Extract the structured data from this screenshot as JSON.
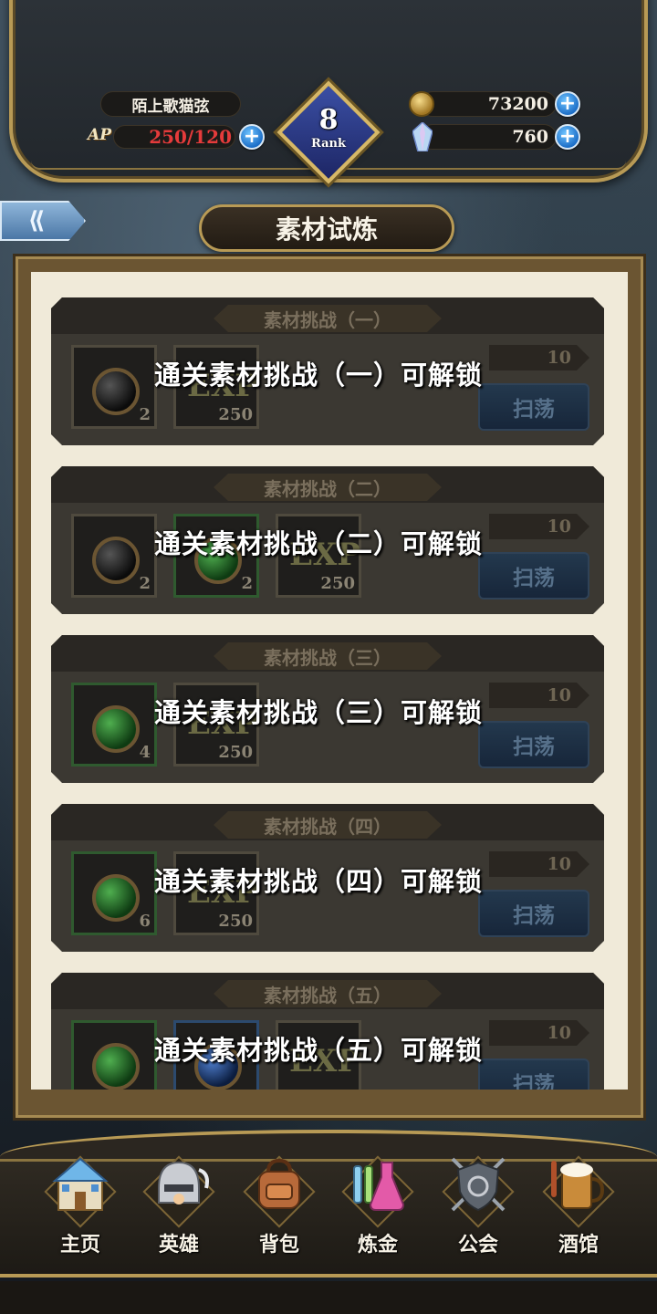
{
  "header": {
    "player_name": "陌上歌猫弦",
    "ap_label": "AP",
    "ap_value": "250/120",
    "rank_number": "8",
    "rank_label": "Rank",
    "gold": "73200",
    "crystals": "760"
  },
  "page": {
    "title": "素材试炼",
    "back_label": "⟪"
  },
  "challenges": [
    {
      "title": "素材挑战（一）",
      "lock_text": "通关素材挑战（一）可解锁",
      "energy_cost": "10",
      "sweep_label": "扫荡",
      "rewards": [
        {
          "type": "orb",
          "color": "black",
          "count": "2"
        },
        {
          "type": "exp",
          "label": "EXP",
          "count": "250"
        }
      ]
    },
    {
      "title": "素材挑战（二）",
      "lock_text": "通关素材挑战（二）可解锁",
      "energy_cost": "10",
      "sweep_label": "扫荡",
      "rewards": [
        {
          "type": "orb",
          "color": "black",
          "count": "2"
        },
        {
          "type": "orb",
          "color": "green",
          "count": "2"
        },
        {
          "type": "exp",
          "label": "EXP",
          "count": "250"
        }
      ]
    },
    {
      "title": "素材挑战（三）",
      "lock_text": "通关素材挑战（三）可解锁",
      "energy_cost": "10",
      "sweep_label": "扫荡",
      "rewards": [
        {
          "type": "orb",
          "color": "green",
          "count": "4"
        },
        {
          "type": "exp",
          "label": "EXP",
          "count": "250"
        }
      ]
    },
    {
      "title": "素材挑战（四）",
      "lock_text": "通关素材挑战（四）可解锁",
      "energy_cost": "10",
      "sweep_label": "扫荡",
      "rewards": [
        {
          "type": "orb",
          "color": "green",
          "count": "6"
        },
        {
          "type": "exp",
          "label": "EXP",
          "count": "250"
        }
      ]
    },
    {
      "title": "素材挑战（五）",
      "lock_text": "通关素材挑战（五）可解锁",
      "energy_cost": "10",
      "sweep_label": "扫荡",
      "rewards": [
        {
          "type": "orb",
          "color": "green",
          "count": ""
        },
        {
          "type": "orb",
          "color": "blue",
          "count": ""
        },
        {
          "type": "exp",
          "label": "EXP",
          "count": ""
        }
      ]
    }
  ],
  "nav": [
    {
      "label": "主页",
      "icon": "castle-icon",
      "color": "#6fb6e8"
    },
    {
      "label": "英雄",
      "icon": "knight-helmet-icon",
      "color": "#c9ccd2"
    },
    {
      "label": "背包",
      "icon": "backpack-icon",
      "color": "#b86a3a"
    },
    {
      "label": "炼金",
      "icon": "alchemy-flask-icon",
      "color": "#e35aa8"
    },
    {
      "label": "公会",
      "icon": "guild-shield-icon",
      "color": "#9aa2ab"
    },
    {
      "label": "酒馆",
      "icon": "tavern-mug-icon",
      "color": "#c98b3a"
    }
  ],
  "colors": {
    "gold_trim": "#b89a55",
    "ap_red": "#e53b3b",
    "panel_bg": "#f0ead9",
    "card_bg": "#3b3832"
  }
}
